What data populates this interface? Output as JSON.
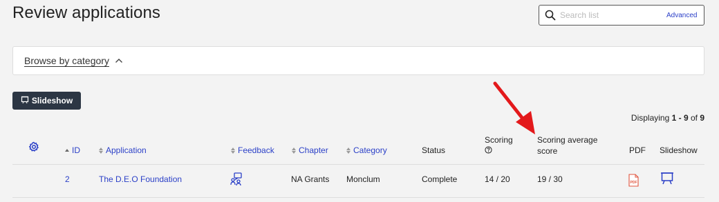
{
  "page": {
    "title": "Review applications"
  },
  "search": {
    "placeholder": "Search list",
    "value": "",
    "advanced_label": "Advanced"
  },
  "browse": {
    "label": "Browse by category"
  },
  "toolbar": {
    "slideshow_label": "Slideshow"
  },
  "pagination": {
    "prefix": "Displaying ",
    "range": "1 - 9",
    "of_label": " of ",
    "total": "9"
  },
  "table": {
    "columns": {
      "id": "ID",
      "application": "Application",
      "feedback": "Feedback",
      "chapter": "Chapter",
      "category": "Category",
      "status": "Status",
      "scoring": "Scoring",
      "scoring_average_line1": "Scoring average",
      "scoring_average_line2": "score",
      "pdf": "PDF",
      "slideshow": "Slideshow"
    },
    "rows": [
      {
        "id": "2",
        "application": "The D.E.O Foundation",
        "chapter": "NA Grants",
        "category": "Monclum",
        "status": "Complete",
        "scoring": "14 / 20",
        "scoring_average": "19 / 30"
      }
    ]
  },
  "colors": {
    "accent": "#2a3fc7",
    "button_bg": "#2c3644",
    "annotation_arrow": "#e3191b",
    "pdf_icon": "#e0533c"
  }
}
